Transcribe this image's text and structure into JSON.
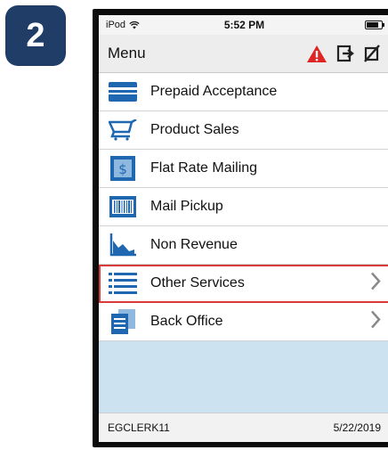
{
  "step_badge": "2",
  "status_bar": {
    "device": "iPod",
    "time": "5:52 PM"
  },
  "header": {
    "title": "Menu"
  },
  "menu": {
    "items": [
      {
        "label": "Prepaid Acceptance",
        "icon": "card-icon"
      },
      {
        "label": "Product Sales",
        "icon": "cart-icon"
      },
      {
        "label": "Flat Rate Mailing",
        "icon": "stamp-icon"
      },
      {
        "label": "Mail Pickup",
        "icon": "barcode-icon"
      },
      {
        "label": "Non Revenue",
        "icon": "chart-icon"
      },
      {
        "label": "Other Services",
        "icon": "list-icon",
        "selected": true,
        "has_chevron": true
      },
      {
        "label": "Back Office",
        "icon": "documents-icon",
        "has_chevron": true
      }
    ]
  },
  "footer": {
    "user": "EGCLERK11",
    "date": "5/22/2019"
  },
  "colors": {
    "accent_blue": "#1f67b1",
    "highlight_red": "#d93a3a",
    "badge_navy": "#1f3d66",
    "screen_bg": "#cde2f1"
  }
}
